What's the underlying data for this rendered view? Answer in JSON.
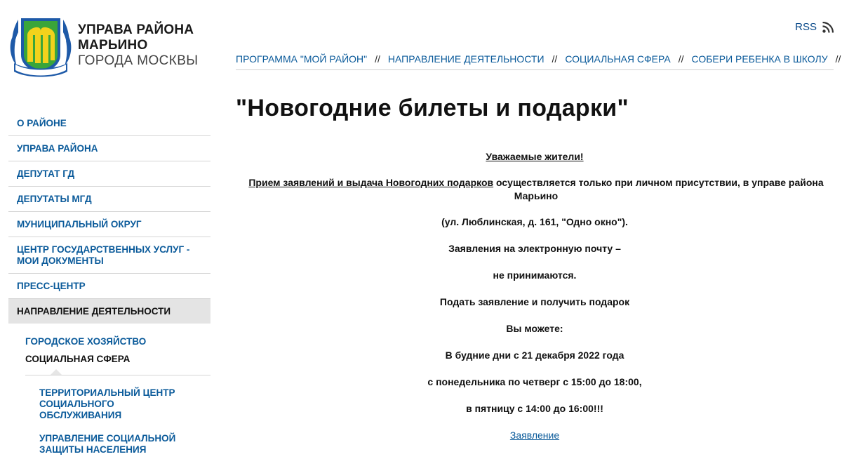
{
  "header": {
    "org_line1": "УПРАВА РАЙОНА",
    "org_line2": "МАРЬИНО",
    "org_line3": "ГОРОДА МОСКВЫ",
    "logo_text": "МАРЬИНО",
    "rss_label": "RSS"
  },
  "breadcrumb": {
    "items": [
      "ПРОГРАММА \"МОЙ РАЙОН\"",
      "НАПРАВЛЕНИЕ ДЕЯТЕЛЬНОСТИ",
      "СОЦИАЛЬНАЯ СФЕРА",
      "СОБЕРИ РЕБЕНКА В ШКОЛУ"
    ],
    "separator": "//"
  },
  "sidebar": {
    "items": [
      "О РАЙОНЕ",
      "УПРАВА РАЙОНА",
      "ДЕПУТАТ ГД",
      "ДЕПУТАТЫ МГД",
      "МУНИЦИПАЛЬНЫЙ ОКРУГ",
      "ЦЕНТР ГОСУДАРСТВЕННЫХ УСЛУГ - МОИ ДОКУМЕНТЫ",
      "ПРЕСС-ЦЕНТР"
    ],
    "active_item": "НАПРАВЛЕНИЕ ДЕЯТЕЛЬНОСТИ",
    "sub_items": [
      "ГОРОДСКОЕ ХОЗЯЙСТВО",
      "СОЦИАЛЬНАЯ СФЕРА"
    ],
    "sub2_items": [
      "ТЕРРИТОРИАЛЬНЫЙ ЦЕНТР СОЦИАЛЬНОГО ОБСЛУЖИВАНИЯ",
      "УПРАВЛЕНИЕ СОЦИАЛЬНОЙ ЗАЩИТЫ НАСЕЛЕНИЯ"
    ]
  },
  "main": {
    "title": "\"Новогодние билеты и подарки\"",
    "greeting": "Уважаемые жители!",
    "intro_underlined": "Прием заявлений и выдача Новогодних подарков",
    "intro_rest": " осуществляется только при личном присутствии, в управе района Марьино",
    "address": "(ул. Люблинская, д. 161, \"Одно окно\").",
    "email_line1": "Заявления на электронную почту –",
    "email_line2": "не принимаются.",
    "apply_line1": "Подать заявление и получить подарок",
    "apply_line2": "Вы можете:",
    "schedule_line1": "В будние дни с 21 декабря 2022 года",
    "schedule_line2": "с понедельника по четверг с 15:00 до 18:00,",
    "schedule_line3": "в пятницу с 14:00 до 16:00!!!",
    "link_label": "Заявление"
  },
  "colors": {
    "link": "#0a5a9a",
    "active_bg": "#e4e4e4",
    "logo_blue": "#1e5aa8",
    "logo_green": "#3aa53a",
    "logo_yellow": "#f2d21c"
  }
}
